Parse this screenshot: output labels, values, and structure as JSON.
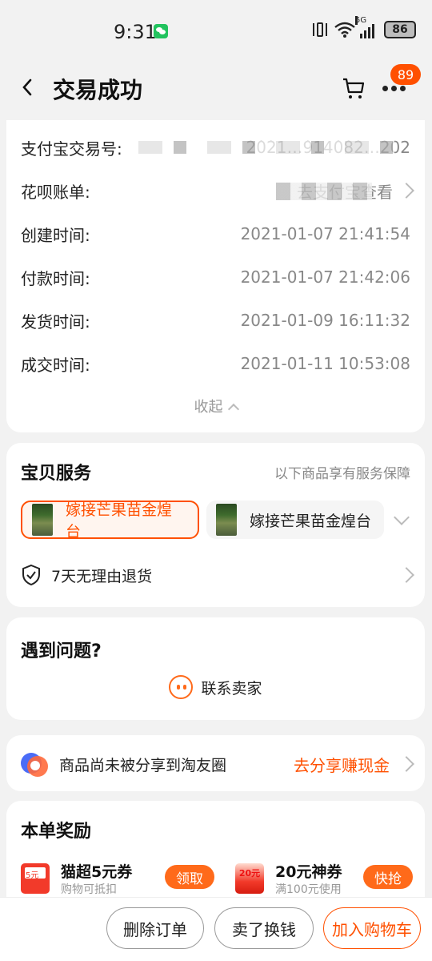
{
  "status_bar": {
    "time": "9:31",
    "network": "5G",
    "battery": "86"
  },
  "nav": {
    "title": "交易成功",
    "badge_count": "89"
  },
  "order_info": {
    "rows": [
      {
        "label": "支付宝交易号:",
        "value": "2021…914082…202"
      },
      {
        "label": "花呗账单:",
        "value": "去支付宝查看"
      },
      {
        "label": "创建时间:",
        "value": "2021-01-07 21:41:54"
      },
      {
        "label": "付款时间:",
        "value": "2021-01-07 21:42:06"
      },
      {
        "label": "发货时间:",
        "value": "2021-01-09 16:11:32"
      },
      {
        "label": "成交时间:",
        "value": "2021-01-11 10:53:08"
      }
    ],
    "collapse_label": "收起"
  },
  "service": {
    "title": "宝贝服务",
    "subtitle": "以下商品享有服务保障",
    "items": [
      {
        "label": "嫁接芒果苗金煌台"
      },
      {
        "label": "嫁接芒果苗金煌台"
      }
    ],
    "return_policy": "7天无理由退货"
  },
  "problem": {
    "title": "遇到问题?",
    "contact_label": "联系卖家"
  },
  "share": {
    "text": "商品尚未被分享到淘友圈",
    "action": "去分享赚现金"
  },
  "reward": {
    "title": "本单奖励",
    "items": [
      {
        "icon_text": "5元",
        "title": "猫超5元券",
        "subtitle": "购物可抵扣",
        "button": "领取"
      },
      {
        "icon_text": "20元",
        "title": "20元神券",
        "subtitle": "满100元使用",
        "button": "快抢"
      }
    ]
  },
  "bottom_actions": {
    "delete": "删除订单",
    "sell": "卖了换钱",
    "add_cart": "加入购物车"
  },
  "colors": {
    "accent": "#ff5000",
    "background": "#f2f2f2"
  }
}
